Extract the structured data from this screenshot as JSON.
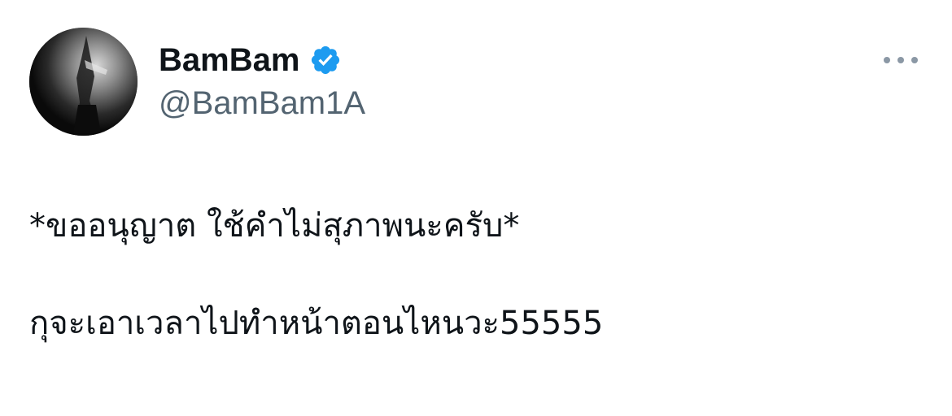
{
  "author": {
    "display_name": "BamBam",
    "handle": "@BamBam1A",
    "verified": true,
    "verified_color": "#1d9bf0"
  },
  "tweet": {
    "lines": [
      "*ขออนุญาต ใช้คำไม่สุภาพนะครับ*",
      "กุจะเอาเวลาไปทำหน้าตอนไหนวะ55555"
    ]
  },
  "icons": {
    "more": "more-options-icon",
    "verified": "verified-badge-icon"
  },
  "colors": {
    "text": "#0f1419",
    "secondary": "#536471",
    "background": "#ffffff"
  }
}
